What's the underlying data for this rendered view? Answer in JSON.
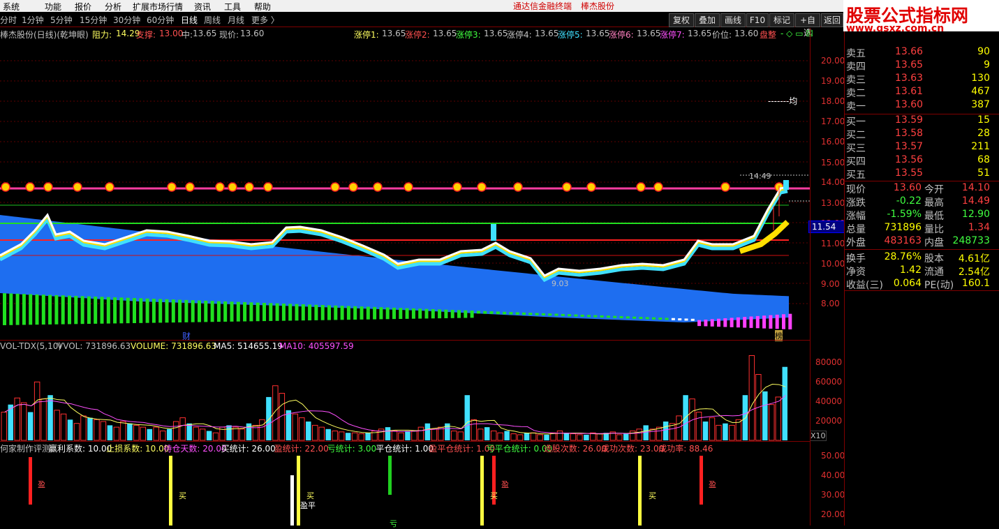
{
  "menu": {
    "items": [
      "系统",
      "功能",
      "报价",
      "分析",
      "扩展市场行情",
      "资讯",
      "工具",
      "帮助"
    ],
    "center_left": "通达信金融终端",
    "center_right": "棒杰股份"
  },
  "timeframes": [
    "分时",
    "1分钟",
    "5分钟",
    "15分钟",
    "30分钟",
    "60分钟",
    "日线",
    "周线",
    "月线",
    "更多 〉"
  ],
  "active_timeframe": "日线",
  "right_buttons": [
    "复权",
    "叠加",
    "画线",
    "F10",
    "标记",
    "+自选",
    "返回"
  ],
  "logo": {
    "line1": "股票公式指标网",
    "line2": "www.gsxz.com.cn"
  },
  "main_info": {
    "title": "棒杰股份(日线)(乾坤眼)",
    "resist_label": "阻力:",
    "resist": "14.29",
    "support_label": "支撑:",
    "support": "13.00",
    "mid_label": "中:",
    "mid": "13.65",
    "now_label": "现价:",
    "now": "13.60",
    "zt": [
      {
        "label": "涨停1:",
        "value": "13.65",
        "color": "#ffff60"
      },
      {
        "label": "涨停2:",
        "value": "13.65",
        "color": "#ff5050"
      },
      {
        "label": "涨停3:",
        "value": "13.65",
        "color": "#40ff40"
      },
      {
        "label": "涨停4:",
        "value": "13.65",
        "color": "#c0c0c0"
      },
      {
        "label": "涨停5:",
        "value": "13.65",
        "color": "#40e0ff"
      },
      {
        "label": "涨停6:",
        "value": "13.65",
        "color": "#ff80c0"
      },
      {
        "label": "涨停7:",
        "value": "13.65",
        "color": "#ff50ff"
      }
    ],
    "price_pos_label": "价位:",
    "price_pos": "13.60",
    "state": "盘整"
  },
  "price_axis": [
    "20.00",
    "19.00",
    "18.00",
    "17.00",
    "16.00",
    "15.00",
    "14.00",
    "13.00",
    "12.00",
    "11.00",
    "10.00",
    "9.00",
    "8.00"
  ],
  "chart_annotations": {
    "high": "14.49",
    "low": "9.03",
    "avg_label": "-------均",
    "cai": "财",
    "bang": "榜",
    "current_tag": "11.54"
  },
  "volume_info": {
    "name": "VOL-TDX(5,10)",
    "vvol": "VVOL: 731896.63",
    "volume": "VOLUME: 731896.63",
    "ma5": "MA5: 514655.19",
    "ma10": "MA10: 405597.59"
  },
  "volume_axis": [
    "80000",
    "60000",
    "40000",
    "20000"
  ],
  "volume_unit": "X10",
  "sub_info": {
    "name": "何家制作评测",
    "items": [
      {
        "text": "赢利系数: 10.00",
        "color": "#ffffff"
      },
      {
        "text": "止损系数: 10.00",
        "color": "#ffff60"
      },
      {
        "text": "待仓天数: 20.00",
        "color": "#ff50ff"
      },
      {
        "text": "买统计: 26.00",
        "color": "#ffffff"
      },
      {
        "text": "盈统计: 22.00",
        "color": "#ff5050"
      },
      {
        "text": "亏统计: 3.00",
        "color": "#40ff40"
      },
      {
        "text": "平仓统计: 1.00",
        "color": "#ffffff"
      },
      {
        "text": "盈平仓统计: 1.00",
        "color": "#ff5050"
      },
      {
        "text": "亏平仓统计: 0.00",
        "color": "#40ff40"
      },
      {
        "text": "选股次数: 26.00",
        "color": "#ff5050"
      },
      {
        "text": "成功次数: 23.00",
        "color": "#ff5050"
      },
      {
        "text": "成功率: 88.46",
        "color": "#ff5050"
      }
    ]
  },
  "sub_axis": [
    "50.00",
    "40.00",
    "30.00",
    "20.00"
  ],
  "sub_labels": {
    "ying": "盈",
    "mai": "买",
    "yingping": "盈平",
    "kui": "亏"
  },
  "quote": {
    "sell": [
      {
        "label": "卖五",
        "price": "13.66",
        "vol": "90",
        "color": "#ff4040"
      },
      {
        "label": "卖四",
        "price": "13.65",
        "vol": "9",
        "color": "#ff4040"
      },
      {
        "label": "卖三",
        "price": "13.63",
        "vol": "130",
        "color": "#ff4040"
      },
      {
        "label": "卖二",
        "price": "13.61",
        "vol": "467",
        "color": "#ff4040"
      },
      {
        "label": "卖一",
        "price": "13.60",
        "vol": "387",
        "color": "#ff4040"
      }
    ],
    "buy": [
      {
        "label": "买一",
        "price": "13.59",
        "vol": "15",
        "color": "#ff4040"
      },
      {
        "label": "买二",
        "price": "13.58",
        "vol": "28",
        "color": "#ff4040"
      },
      {
        "label": "买三",
        "price": "13.57",
        "vol": "211",
        "color": "#ff4040"
      },
      {
        "label": "买四",
        "price": "13.56",
        "vol": "68",
        "color": "#ff4040"
      },
      {
        "label": "买五",
        "price": "13.55",
        "vol": "51",
        "color": "#ff4040"
      }
    ],
    "stats": [
      {
        "l1": "现价",
        "v1": "13.60",
        "c1": "#ff4040",
        "l2": "今开",
        "v2": "14.10",
        "c2": "#ff4040"
      },
      {
        "l1": "涨跌",
        "v1": "-0.22",
        "c1": "#40ff40",
        "l2": "最高",
        "v2": "14.49",
        "c2": "#ff4040"
      },
      {
        "l1": "涨幅",
        "v1": "-1.59%",
        "c1": "#40ff40",
        "l2": "最低",
        "v2": "12.90",
        "c2": "#40ff40"
      },
      {
        "l1": "总量",
        "v1": "731896",
        "c1": "#ffff00",
        "l2": "量比",
        "v2": "1.34",
        "c2": "#ff4040"
      },
      {
        "l1": "外盘",
        "v1": "483163",
        "c1": "#ff4040",
        "l2": "内盘",
        "v2": "248733",
        "c2": "#40ff40"
      },
      {
        "l1": "换手",
        "v1": "28.76%",
        "c1": "#ffff00",
        "l2": "股本",
        "v2": "4.61亿",
        "c2": "#ffff00"
      },
      {
        "l1": "净资",
        "v1": "1.42",
        "c1": "#ffff00",
        "l2": "流通",
        "v2": "2.54亿",
        "c2": "#ffff00"
      },
      {
        "l1": "收益(三)",
        "v1": "0.064",
        "c1": "#ffff00",
        "l2": "PE(动)",
        "v2": "160.1",
        "c2": "#ffff00"
      }
    ]
  }
}
